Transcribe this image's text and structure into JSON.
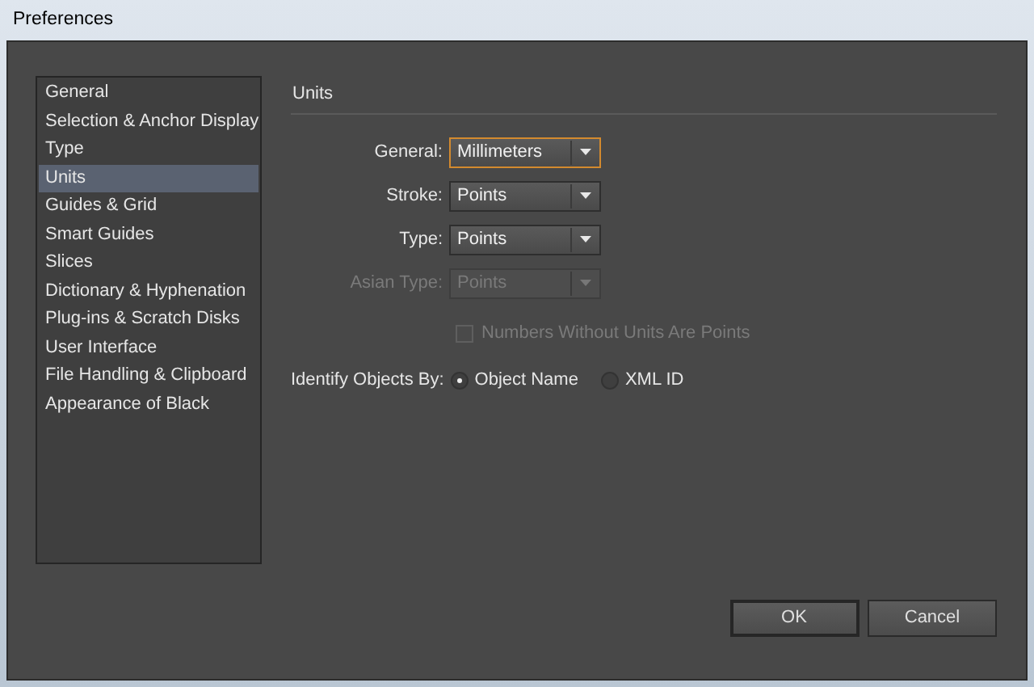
{
  "window": {
    "title": "Preferences"
  },
  "sidebar": {
    "items": [
      {
        "label": "General",
        "selected": false
      },
      {
        "label": "Selection & Anchor Display",
        "selected": false
      },
      {
        "label": "Type",
        "selected": false
      },
      {
        "label": "Units",
        "selected": true
      },
      {
        "label": "Guides & Grid",
        "selected": false
      },
      {
        "label": "Smart Guides",
        "selected": false
      },
      {
        "label": "Slices",
        "selected": false
      },
      {
        "label": "Dictionary & Hyphenation",
        "selected": false
      },
      {
        "label": "Plug-ins & Scratch Disks",
        "selected": false
      },
      {
        "label": "User Interface",
        "selected": false
      },
      {
        "label": "File Handling & Clipboard",
        "selected": false
      },
      {
        "label": "Appearance of Black",
        "selected": false
      }
    ]
  },
  "section": {
    "title": "Units",
    "dropdowns": [
      {
        "label": "General:",
        "value": "Millimeters",
        "disabled": false,
        "focused": true
      },
      {
        "label": "Stroke:",
        "value": "Points",
        "disabled": false,
        "focused": false
      },
      {
        "label": "Type:",
        "value": "Points",
        "disabled": false,
        "focused": false
      },
      {
        "label": "Asian Type:",
        "value": "Points",
        "disabled": true,
        "focused": false
      }
    ],
    "checkbox": {
      "label": "Numbers Without Units Are Points",
      "checked": false,
      "disabled": true
    },
    "identify": {
      "label": "Identify Objects By:",
      "options": [
        {
          "label": "Object Name",
          "selected": true
        },
        {
          "label": "XML ID",
          "selected": false
        }
      ]
    }
  },
  "buttons": [
    {
      "label": "OK",
      "default": true
    },
    {
      "label": "Cancel",
      "default": false
    }
  ]
}
